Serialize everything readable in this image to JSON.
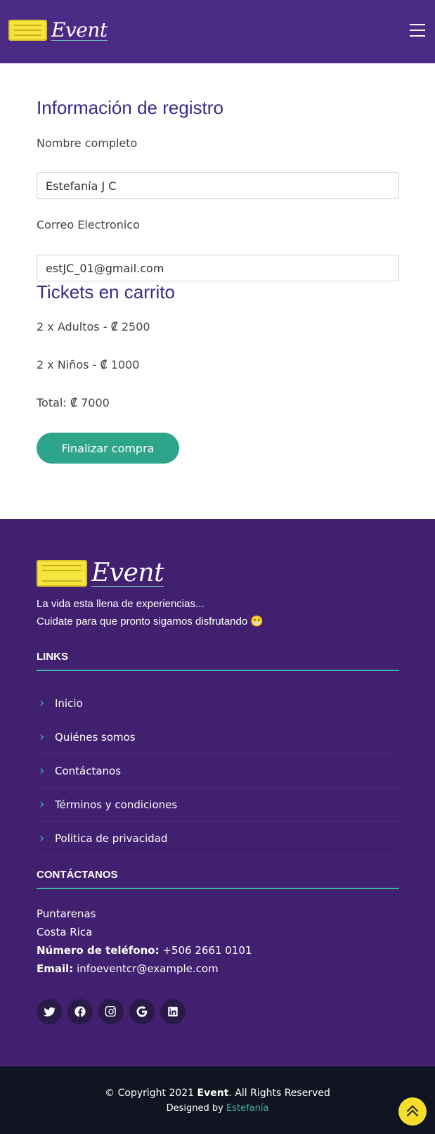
{
  "header": {
    "logo_text": "Event",
    "menu_icon": "hamburger-menu-icon"
  },
  "registration": {
    "title": "Información de registro",
    "name_label": "Nombre completo",
    "name_value": "Estefanía J C",
    "email_label": "Correo Electronico",
    "email_value": "estJC_01@gmail.com"
  },
  "cart": {
    "title": "Tickets en carrito",
    "items": [
      "2 x Adultos - ₡ 2500",
      "2 x Niños - ₡ 1000"
    ],
    "total": "Total: ₡ 7000",
    "button_label": "Finalizar compra"
  },
  "footer": {
    "logo_text": "Event",
    "tagline": [
      "La vida esta llena de experiencias...",
      "Cuidate para que pronto sigamos disfrutando 😁"
    ],
    "links_title": "LINKS",
    "links": [
      "Inicio",
      "Quiénes somos",
      "Contáctanos",
      "Términos y condiciones",
      "Politica de privacidad"
    ],
    "contact_title": "CONTÁCTANOS",
    "address": [
      "Puntarenas",
      "Costa Rica"
    ],
    "phone_label": "Número de teléfono:",
    "phone_value": "+506 2661 0101",
    "email_label": "Email:",
    "email_value": "infoeventcr@example.com",
    "socials": [
      "twitter-icon",
      "facebook-icon",
      "instagram-icon",
      "google-icon",
      "linkedin-icon"
    ]
  },
  "bottom": {
    "copyright_prefix": "© Copyright 2021",
    "brand": "Event",
    "copyright_suffix": ". All Rights Reserved",
    "designed_prefix": "Designed by",
    "designer": "Estefanía"
  },
  "colors": {
    "header": "#4b2a85",
    "footer": "#40206f",
    "accent": "#2ea58a",
    "title": "#3b2a86",
    "bottom_bar": "#0f1420",
    "totop": "#f4dd2c"
  }
}
